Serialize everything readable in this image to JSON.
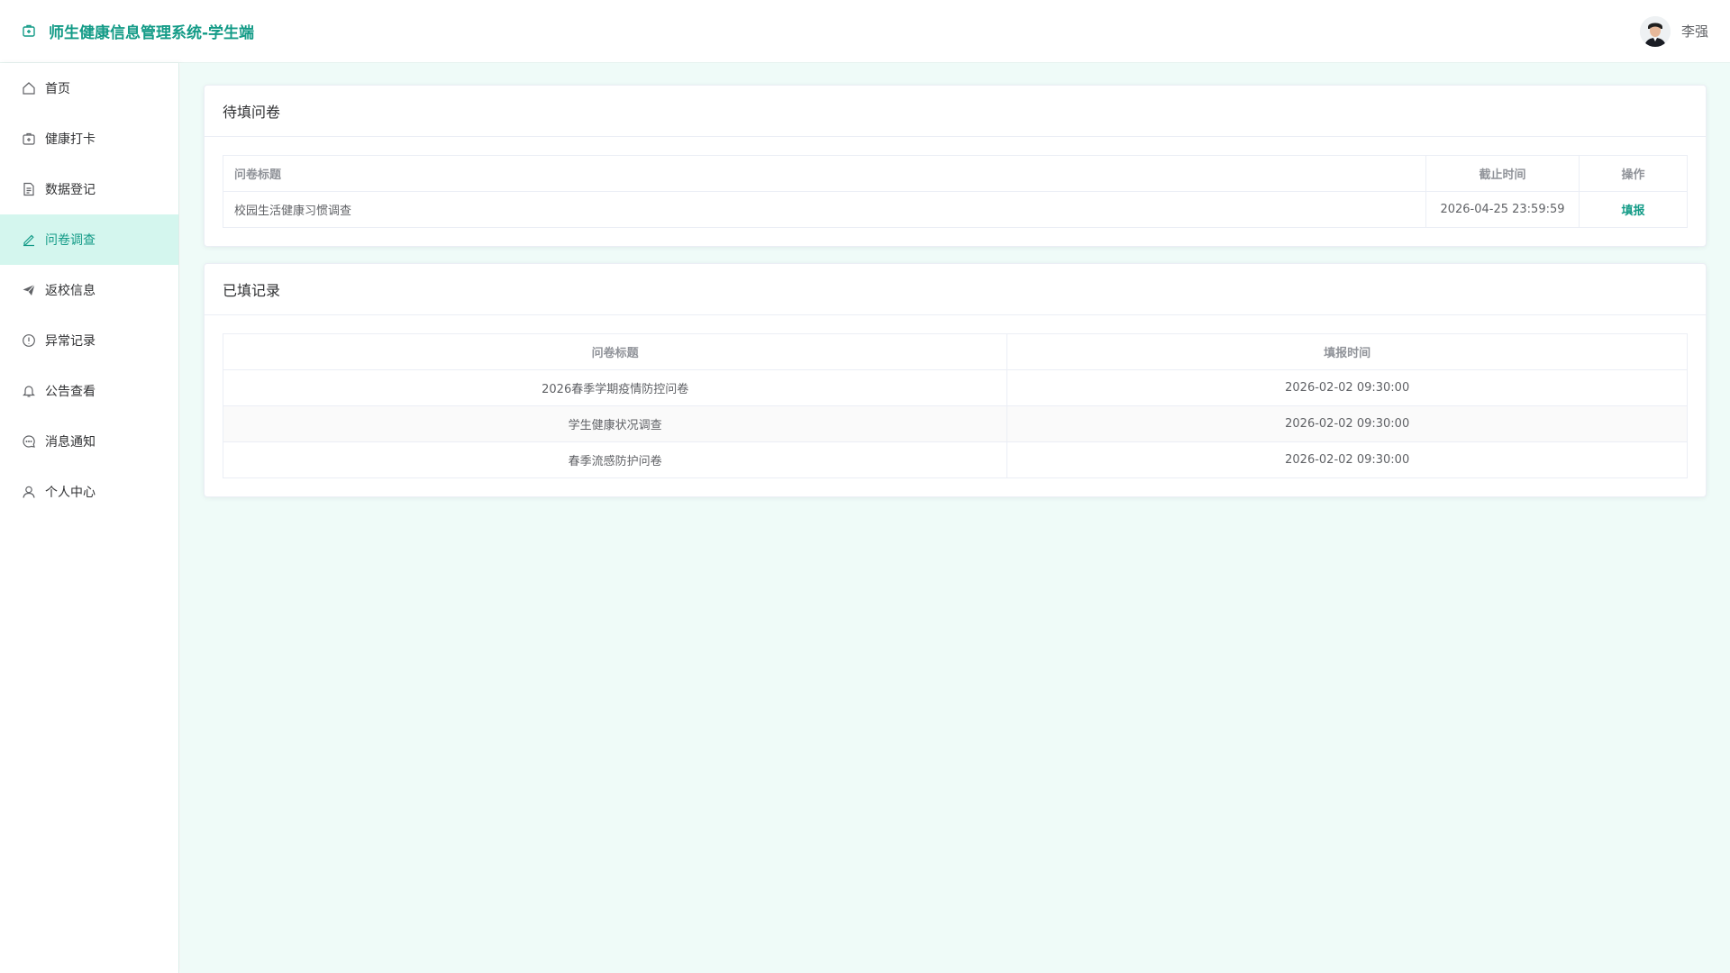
{
  "header": {
    "title": "师生健康信息管理系统-学生端",
    "user_name": "李强",
    "brand_icon": "medical-kit-icon",
    "accent_color": "#139b87"
  },
  "sidebar": {
    "items": [
      {
        "label": "首页",
        "icon": "home-icon"
      },
      {
        "label": "健康打卡",
        "icon": "medical-kit-icon"
      },
      {
        "label": "数据登记",
        "icon": "document-icon"
      },
      {
        "label": "问卷调查",
        "icon": "pencil-icon",
        "active": true
      },
      {
        "label": "返校信息",
        "icon": "paper-plane-icon"
      },
      {
        "label": "异常记录",
        "icon": "warning-circle-icon"
      },
      {
        "label": "公告查看",
        "icon": "bell-icon"
      },
      {
        "label": "消息通知",
        "icon": "chat-bubble-icon"
      },
      {
        "label": "个人中心",
        "icon": "user-icon"
      }
    ]
  },
  "pending": {
    "title": "待填问卷",
    "columns": [
      "问卷标题",
      "截止时间",
      "操作"
    ],
    "rows": [
      {
        "title": "校园生活健康习惯调查",
        "deadline": "2026-04-25 23:59:59",
        "action": "填报"
      }
    ]
  },
  "completed": {
    "title": "已填记录",
    "columns": [
      "问卷标题",
      "填报时间"
    ],
    "rows": [
      {
        "title": "2026春季学期疫情防控问卷",
        "time": "2026-02-02 09:30:00"
      },
      {
        "title": "学生健康状况调查",
        "time": "2026-02-02 09:30:00"
      },
      {
        "title": "春季流感防护问卷",
        "time": "2026-02-02 09:30:00"
      }
    ]
  }
}
